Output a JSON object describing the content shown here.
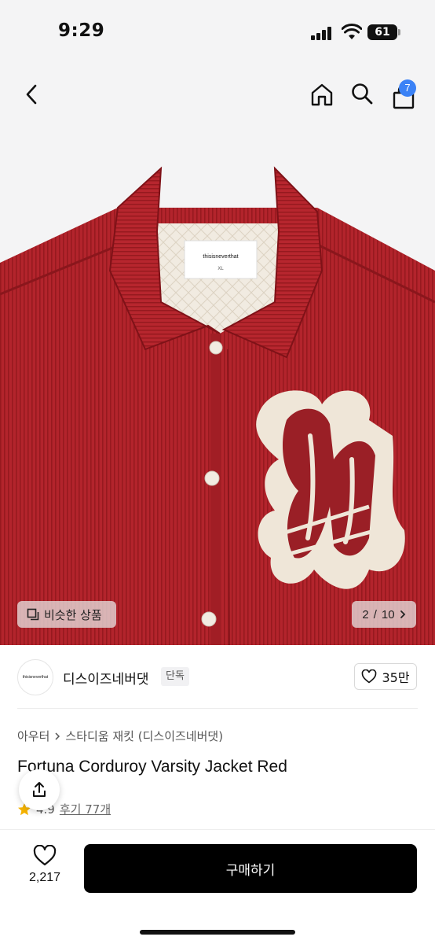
{
  "status": {
    "time": "9:29",
    "battery": "61"
  },
  "header": {
    "cart_count": "7"
  },
  "gallery": {
    "similar_label": "비슷한 상품",
    "page_current": "2",
    "page_total": "10",
    "page_separator": "/",
    "label_tag": "thisisneverthat",
    "label_size": "XL"
  },
  "brand": {
    "logo_text": "thisisneverthat",
    "name": "디스이즈네버댓",
    "tag": "단독",
    "likes": "35만"
  },
  "breadcrumb": {
    "category": "아우터",
    "subcategory": "스타디움 재킷 (디스이즈네버댓)"
  },
  "product": {
    "title": "Fortuna Corduroy Varsity Jacket Red",
    "rating": "4.9",
    "reviews": "후기 77개"
  },
  "bottom": {
    "wish_count": "2,217",
    "buy_label": "구매하기"
  },
  "colors": {
    "jacket_red": "#b3242c",
    "patch_cream": "#efe6d8",
    "patch_red": "#9a1f26",
    "badge_blue": "#3b82f6",
    "rating_star": "#f5b301"
  },
  "icons": [
    "back-icon",
    "home-icon",
    "search-icon",
    "cart-icon",
    "similar-icon",
    "chevron-right-icon",
    "heart-icon",
    "share-icon",
    "star-icon"
  ]
}
